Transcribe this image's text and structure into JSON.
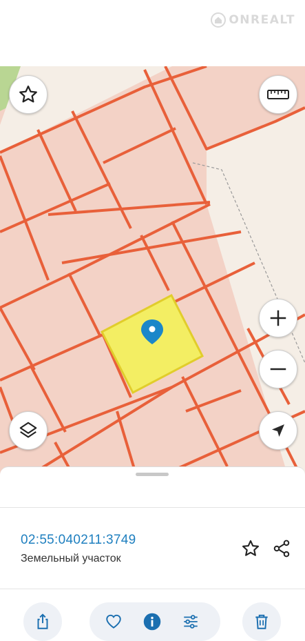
{
  "watermark": {
    "text": "ONREALT"
  },
  "map": {
    "colors": {
      "background": "#f3d2c6",
      "road": "#f5eee6",
      "parcel_outline": "#e8603a",
      "selected_fill": "#f3ee63",
      "selected_outline": "#e1cd2b",
      "pin": "#1b87c9",
      "green_area": "#b9d693"
    },
    "buttons": {
      "favorite": "star-icon",
      "ruler": "ruler-icon",
      "layers": "layers-icon",
      "zoom_in": "plus-icon",
      "zoom_out": "minus-icon",
      "locate": "navigation-arrow-icon"
    }
  },
  "parcel": {
    "cadastral_number": "02:55:040211:3749",
    "type": "Земельный участок"
  },
  "actions": {
    "share": "share-icon",
    "like": "heart-icon",
    "info": "info-icon",
    "filters": "sliders-icon",
    "delete": "trash-icon",
    "favorite": "star-outline-icon",
    "share_link": "share-nodes-icon"
  }
}
